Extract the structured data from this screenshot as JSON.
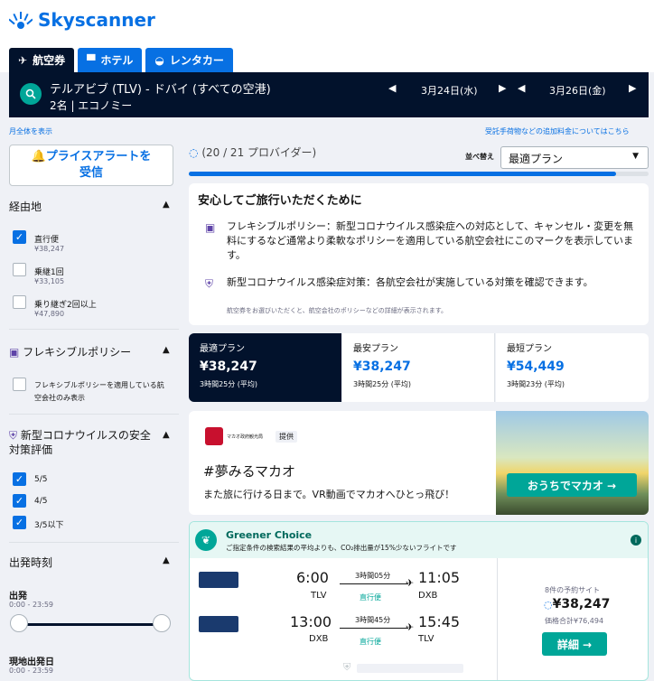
{
  "brand": {
    "name": "Skyscanner"
  },
  "tabs": [
    {
      "label": "航空券"
    },
    {
      "label": "ホテル"
    },
    {
      "label": "レンタカー"
    }
  ],
  "search": {
    "route": "テルアビブ (TLV) - ドバイ (すべての空港)",
    "passengers": "2名 | エコノミー",
    "depart_date": "3月24日(水)",
    "return_date": "3月26日(金)"
  },
  "links": {
    "show_all": "月全体を表示",
    "fees": "受託手荷物などの追加料金についてはこちら"
  },
  "alert": {
    "line1": "プライスアラートを",
    "line2": "受信"
  },
  "providers": "(20 / 21 プロバイダー)",
  "progress": 0.93,
  "sort": {
    "label": "並べ替え",
    "value": "最適プラン"
  },
  "filters": {
    "stops": {
      "title": "経由地",
      "options": [
        {
          "label": "直行便",
          "price": "¥38,247",
          "checked": true
        },
        {
          "label": "乗継1回",
          "price": "¥33,105",
          "checked": false
        },
        {
          "label": "乗り継ぎ2回以上",
          "price": "¥47,890",
          "checked": false
        }
      ]
    },
    "flex": {
      "title": "フレキシブルポリシー",
      "option": "フレキシブルポリシーを適用している航空会社のみ表示"
    },
    "covid": {
      "title": "新型コロナウイルスの安全対策評価",
      "options": [
        {
          "label": "5/5",
          "checked": true
        },
        {
          "label": "4/5",
          "checked": true
        },
        {
          "label": "3/5以下",
          "checked": true
        }
      ]
    },
    "times": {
      "title": "出発時刻",
      "depart_label": "出発",
      "depart_range": "0:00 - 23:59",
      "return_label": "現地出発日",
      "return_range": "0:00 - 23:59"
    }
  },
  "safety": {
    "title": "安心してご旅行いただくために",
    "flex_text": "フレキシブルポリシー：新型コロナウイルス感染症への対応として、キャンセル・変更を無料にするなど通常より柔軟なポリシーを適用している航空会社にこのマークを表示しています。",
    "covid_text": "新型コロナウイルス感染症対策：各航空会社が実施している対策を確認できます。",
    "note": "航空券をお選びいただくと、航空会社のポリシーなどの詳細が表示されます。"
  },
  "price_tabs": [
    {
      "label": "最適プラン",
      "price": "¥38,247",
      "duration": "3時間25分 (平均)"
    },
    {
      "label": "最安プラン",
      "price": "¥38,247",
      "duration": "3時間25分 (平均)"
    },
    {
      "label": "最短プラン",
      "price": "¥54,449",
      "duration": "3時間23分 (平均)"
    }
  ],
  "ad": {
    "brand": "マカオ政府観光局",
    "sponsored": "提供",
    "headline": "#夢みるマカオ",
    "text": "また旅に行ける日まで。VR動画でマカオへひとっ飛び！",
    "cta": "おうちでマカオ →"
  },
  "green": {
    "title": "Greener Choice",
    "desc": "ご指定条件の検索結果の平均よりも、CO₂排出量が15%少ないフライトです"
  },
  "flights": [
    {
      "dep": "6:00",
      "dep_code": "TLV",
      "duration": "3時間05分",
      "type": "直行便",
      "arr": "11:05",
      "arr_code": "DXB"
    },
    {
      "dep": "13:00",
      "dep_code": "DXB",
      "duration": "3時間45分",
      "type": "直行便",
      "arr": "15:45",
      "arr_code": "TLV"
    }
  ],
  "deal": {
    "sites": "8件の予約サイト",
    "price": "¥38,247",
    "total": "価格合計¥76,494",
    "button": "詳細 →"
  },
  "colors": {
    "primary": "#0770e3",
    "dark": "#02122c",
    "teal": "#00a698"
  }
}
